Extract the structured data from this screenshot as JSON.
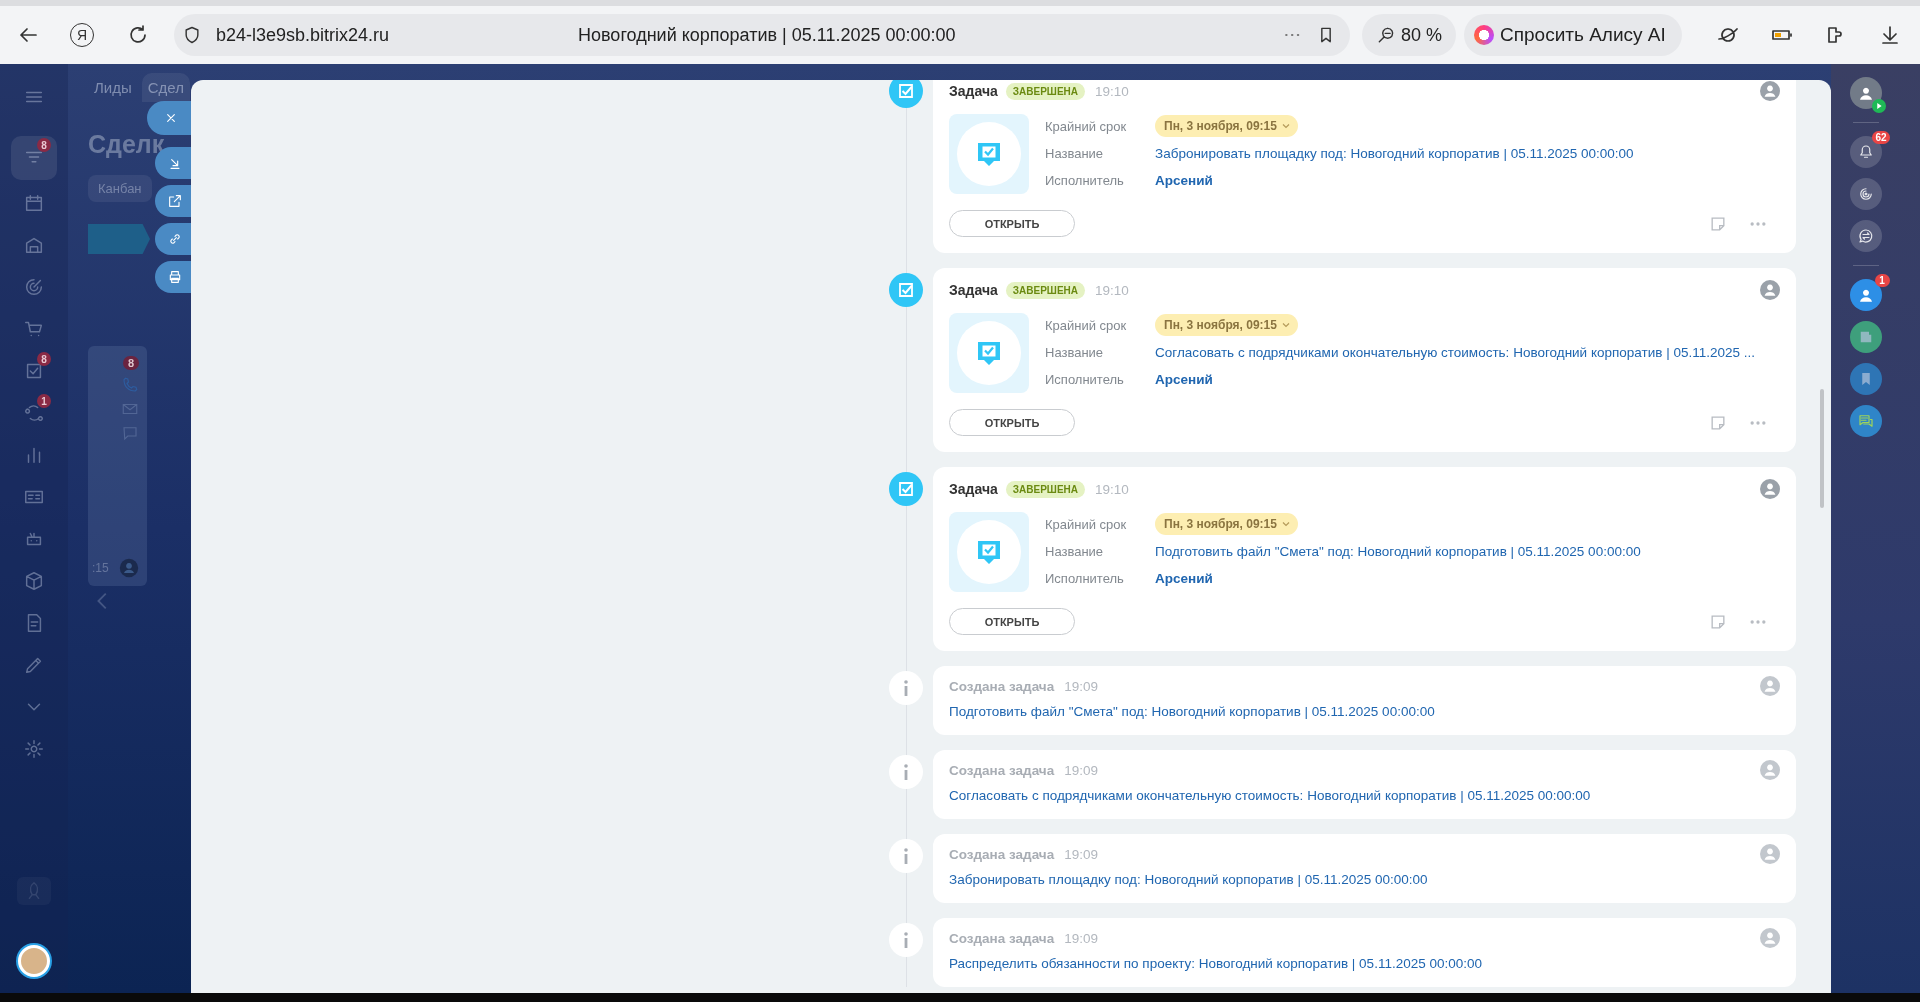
{
  "browser": {
    "logo": "Я",
    "url": "b24-l3e9sb.bitrix24.ru",
    "page_title": "Новогодний корпоратив | 05.11.2025 00:00:00",
    "zoom": "80 %",
    "assistant_button": "Спросить Алису AI"
  },
  "left_menu": [
    {
      "kind": "menu",
      "selected": false
    },
    {
      "kind": "funnel",
      "badge": "8",
      "selected": true
    },
    {
      "kind": "calendar",
      "selected": false
    },
    {
      "kind": "store",
      "selected": false
    },
    {
      "kind": "target",
      "selected": false
    },
    {
      "kind": "cart",
      "selected": false
    },
    {
      "kind": "task",
      "badge": "8",
      "selected": false
    },
    {
      "kind": "flow",
      "badge": "1",
      "selected": false
    },
    {
      "kind": "chart",
      "selected": false
    },
    {
      "kind": "contact",
      "selected": false
    },
    {
      "kind": "robot",
      "selected": false
    },
    {
      "kind": "box",
      "selected": false
    },
    {
      "kind": "document",
      "selected": false
    },
    {
      "kind": "pen",
      "selected": false
    },
    {
      "kind": "chevron",
      "selected": false
    },
    {
      "kind": "gear",
      "selected": false
    }
  ],
  "crm": {
    "tabs": [
      {
        "label": "Лиды",
        "selected": false
      },
      {
        "label": "Сдел",
        "selected": true
      }
    ],
    "title": "Сделк",
    "view_tabs": [
      {
        "label": "Канбан",
        "selected": true
      }
    ],
    "deal_card": {
      "badge": "8",
      "time": ":15"
    }
  },
  "slider_buttons": [
    {
      "kind": "close"
    },
    {
      "kind": "minimize"
    },
    {
      "kind": "new-window"
    },
    {
      "kind": "link"
    },
    {
      "kind": "print"
    }
  ],
  "timeline": [
    {
      "kind": "task",
      "title": "Задача",
      "status": "ЗАВЕРШЕНА",
      "time": "19:10",
      "fields": [
        {
          "kind": "deadline",
          "label": "Крайний срок",
          "value": "Пн, 3 ноября, 09:15"
        },
        {
          "kind": "link",
          "label": "Название",
          "value": "Забронировать площадку под: Новогодний корпоратив | 05.11.2025 00:00:00"
        },
        {
          "kind": "person",
          "label": "Исполнитель",
          "value": "Арсений"
        }
      ],
      "button": "ОТКРЫТЬ"
    },
    {
      "kind": "task",
      "title": "Задача",
      "status": "ЗАВЕРШЕНА",
      "time": "19:10",
      "fields": [
        {
          "kind": "deadline",
          "label": "Крайний срок",
          "value": "Пн, 3 ноября, 09:15"
        },
        {
          "kind": "link",
          "label": "Название",
          "value": "Согласовать с подрядчиками окончательную стоимость: Новогодний корпоратив | 05.11.2025 ..."
        },
        {
          "kind": "person",
          "label": "Исполнитель",
          "value": "Арсений"
        }
      ],
      "button": "ОТКРЫТЬ"
    },
    {
      "kind": "task",
      "title": "Задача",
      "status": "ЗАВЕРШЕНА",
      "time": "19:10",
      "fields": [
        {
          "kind": "deadline",
          "label": "Крайний срок",
          "value": "Пн, 3 ноября, 09:15"
        },
        {
          "kind": "link",
          "label": "Название",
          "value": "Подготовить файл \"Смета\" под: Новогодний корпоратив | 05.11.2025 00:00:00"
        },
        {
          "kind": "person",
          "label": "Исполнитель",
          "value": "Арсений"
        }
      ],
      "button": "ОТКРЫТЬ"
    },
    {
      "kind": "created",
      "title": "Создана задача",
      "time": "19:09",
      "link": "Подготовить файл \"Смета\" под: Новогодний корпоратив | 05.11.2025 00:00:00"
    },
    {
      "kind": "created",
      "title": "Создана задача",
      "time": "19:09",
      "link": "Согласовать с подрядчиками окончательную стоимость: Новогодний корпоратив | 05.11.2025 00:00:00"
    },
    {
      "kind": "created",
      "title": "Создана задача",
      "time": "19:09",
      "link": "Забронировать площадку под: Новогодний корпоратив | 05.11.2025 00:00:00"
    },
    {
      "kind": "created",
      "title": "Создана задача",
      "time": "19:09",
      "link": "Распределить обязанности по проекту: Новогодний корпоратив | 05.11.2025 00:00:00"
    }
  ],
  "right_bar": {
    "groups": [
      [
        {
          "kind": "user"
        }
      ],
      [
        {
          "kind": "bell",
          "badge": "62"
        },
        {
          "kind": "spiral"
        },
        {
          "kind": "chat-swap"
        }
      ],
      [
        {
          "kind": "photo",
          "badge": "1"
        },
        {
          "kind": "news"
        },
        {
          "kind": "bookmark"
        },
        {
          "kind": "chat"
        }
      ]
    ]
  }
}
